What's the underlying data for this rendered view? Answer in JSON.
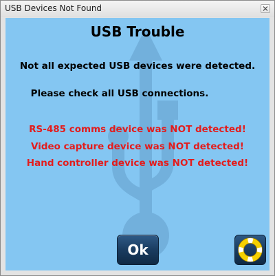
{
  "window": {
    "title": "USB Devices Not Found"
  },
  "dialog": {
    "heading": "USB Trouble",
    "message": "Not all expected USB devices were detected.",
    "instruction": "Please check all USB connections.",
    "errors": [
      "RS-485 comms device was NOT detected!",
      "Video capture device was NOT detected!",
      "Hand controller device was NOT detected!"
    ],
    "ok_label": "Ok"
  },
  "icons": {
    "background": "usb-symbol-icon",
    "help": "lifebuoy-icon",
    "close": "close-icon"
  },
  "colors": {
    "panel_background": "#84c6f2",
    "error_text": "#e31c1c",
    "button": "#1a3c60",
    "lifebuoy": "#f5d000"
  }
}
